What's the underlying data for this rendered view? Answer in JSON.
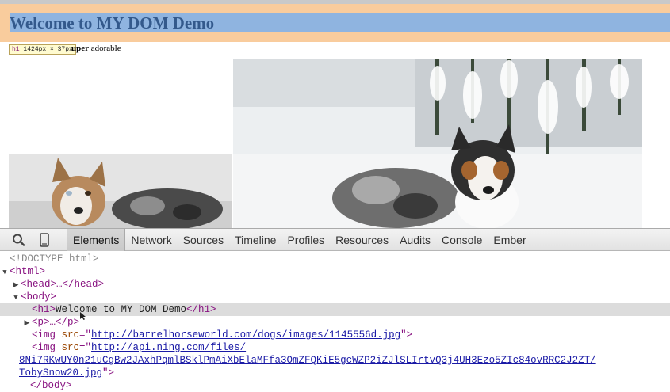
{
  "page": {
    "heading": "Welcome to MY DOM Demo",
    "paragraph_bold": "uper",
    "paragraph_rest": " adorable",
    "tooltip": {
      "tag": "h1",
      "size": "1424px × 37px"
    }
  },
  "devtools": {
    "tabs": [
      "Elements",
      "Network",
      "Sources",
      "Timeline",
      "Profiles",
      "Resources",
      "Audits",
      "Console",
      "Ember"
    ],
    "active_tab": "Elements",
    "dom": {
      "doctype": "<!DOCTYPE html>",
      "html_open": "<html>",
      "head": "<head>…</head>",
      "body_open": "<body>",
      "h1_open": "<h1>",
      "h1_text": "Welcome to MY DOM Demo",
      "h1_close": "</h1>",
      "p": "<p>…</p>",
      "img1_src": "http://barrelhorseworld.com/dogs/images/1145556d.jpg",
      "img2_src_line1": "http://api.ning.com/files/",
      "img2_src_line2": "8Ni7RKwUY0n21uCgBw2JAxhPqmlBSklPmAiXbElaMFfa3OmZFQKiE5gcWZP2iZJlSLIrtvQ3j4UH3Ezo5ZIc84ovRRC2J2ZT/",
      "img2_src_line3": "TobySnow20.jpg",
      "body_close": "</body>"
    }
  }
}
